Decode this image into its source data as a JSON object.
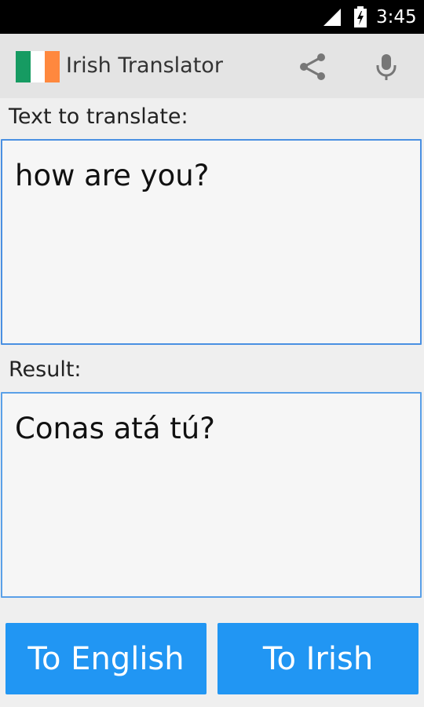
{
  "status_bar": {
    "time": "3:45",
    "icons": [
      "signal-icon",
      "battery-icon"
    ]
  },
  "app_bar": {
    "title": "Irish Translator",
    "flag_colors": [
      "#169b62",
      "#ffffff",
      "#ff883e"
    ],
    "actions": [
      "share-icon",
      "microphone-icon"
    ]
  },
  "source": {
    "label": "Text to translate:",
    "value": "how are you?"
  },
  "result": {
    "label": "Result:",
    "value": "Conas atá tú?"
  },
  "buttons": {
    "to_english": "To English",
    "to_irish": "To Irish"
  },
  "colors": {
    "accent": "#2196f3",
    "border": "#4a90e2"
  }
}
